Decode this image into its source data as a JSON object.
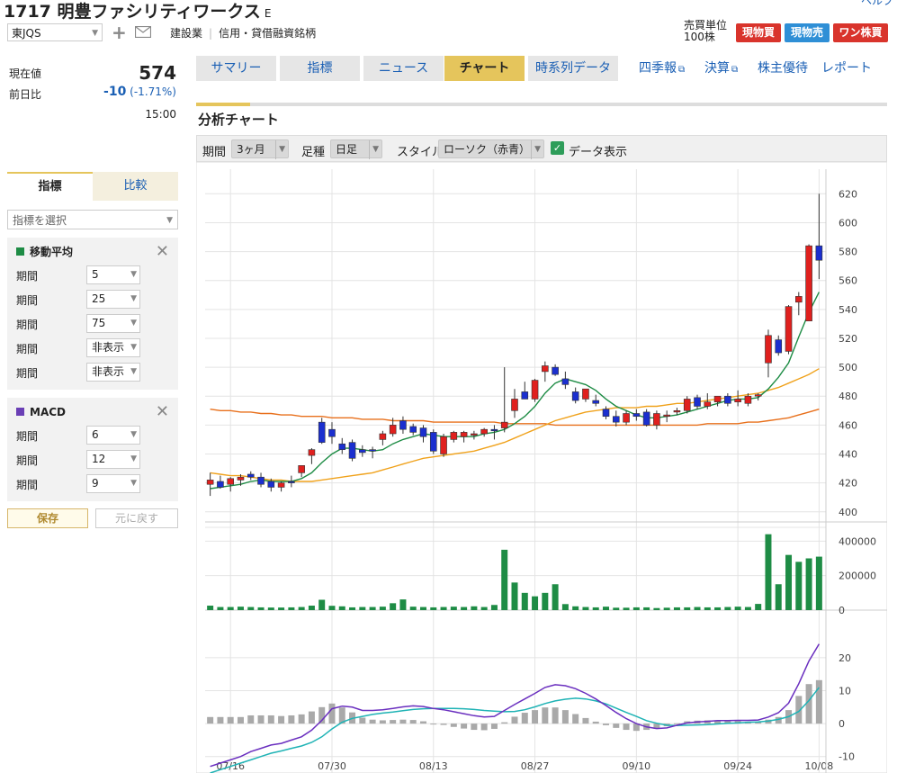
{
  "header": {
    "code": "1717",
    "name": "明豊ファシリティワークス",
    "suffix": "E",
    "corner_link": "ヘルプ",
    "market": "東JQS",
    "industry": "建設業",
    "margin_type": "信用・貸借融資銘柄",
    "unit_label": "売買単位",
    "unit_value": "100株",
    "buttons": {
      "buy": "現物買",
      "sell": "現物売",
      "one": "ワン株買"
    }
  },
  "price": {
    "current_label": "現在値",
    "current_value": "574",
    "change_label": "前日比",
    "change_value": "-10",
    "change_pct": "(-1.71%)",
    "time": "15:00"
  },
  "tabs": [
    {
      "label": "サマリー",
      "active": false
    },
    {
      "label": "指標",
      "active": false
    },
    {
      "label": "ニュース",
      "active": false
    },
    {
      "label": "チャート",
      "active": true
    },
    {
      "label": "時系列データ",
      "active": false
    }
  ],
  "right_links": [
    {
      "label": "四季報",
      "ext": true
    },
    {
      "label": "決算",
      "ext": true
    },
    {
      "label": "株主優待",
      "ext": false
    },
    {
      "label": "レポート",
      "ext": false
    }
  ],
  "section_title": "分析チャート",
  "controls": {
    "period_label": "期間",
    "period_value": "3ヶ月",
    "footype_label": "足種",
    "footype_value": "日足",
    "style_label": "スタイル",
    "style_value": "ローソク（赤青）",
    "data_label": "データ表示",
    "data_checked": true
  },
  "left_panel": {
    "tab_indicator": "指標",
    "tab_compare": "比較",
    "select_placeholder": "指標を選択",
    "ma": {
      "title": "移動平均",
      "color": "#1e8c45",
      "rows": [
        {
          "label": "期間",
          "value": "5"
        },
        {
          "label": "期間",
          "value": "25"
        },
        {
          "label": "期間",
          "value": "75"
        },
        {
          "label": "期間",
          "value": "非表示"
        },
        {
          "label": "期間",
          "value": "非表示"
        }
      ]
    },
    "macd": {
      "title": "MACD",
      "color": "#6a3fb5",
      "rows": [
        {
          "label": "期間",
          "value": "6"
        },
        {
          "label": "期間",
          "value": "12"
        },
        {
          "label": "期間",
          "value": "9"
        }
      ]
    },
    "save": "保存",
    "reset": "元に戻す"
  },
  "chart_data": {
    "type": "candlestick",
    "x_ticks": [
      "07/16",
      "07/30",
      "08/13",
      "08/27",
      "09/10",
      "09/24",
      "10/08"
    ],
    "price_ticks": [
      620,
      600,
      580,
      560,
      540,
      520,
      500,
      480,
      460,
      440,
      420,
      400
    ],
    "price_range": [
      393,
      637
    ],
    "volume_ticks": [
      "400000",
      "200000",
      "0"
    ],
    "volume_range": [
      0,
      480000
    ],
    "macd_ticks": [
      20,
      10,
      0,
      -10
    ],
    "macd_range": [
      -15,
      29
    ],
    "candles": [
      {
        "o": 419,
        "h": 427,
        "l": 411,
        "c": 422
      },
      {
        "o": 421,
        "h": 425,
        "l": 416,
        "c": 417
      },
      {
        "o": 419,
        "h": 424,
        "l": 414,
        "c": 423
      },
      {
        "o": 422,
        "h": 426,
        "l": 418,
        "c": 424
      },
      {
        "o": 426,
        "h": 428,
        "l": 422,
        "c": 424
      },
      {
        "o": 424,
        "h": 427,
        "l": 417,
        "c": 419
      },
      {
        "o": 421,
        "h": 423,
        "l": 414,
        "c": 417
      },
      {
        "o": 417,
        "h": 421,
        "l": 414,
        "c": 420
      },
      {
        "o": 421,
        "h": 425,
        "l": 417,
        "c": 420
      },
      {
        "o": 427,
        "h": 432,
        "l": 424,
        "c": 432
      },
      {
        "o": 439,
        "h": 444,
        "l": 433,
        "c": 443
      },
      {
        "o": 462,
        "h": 465,
        "l": 447,
        "c": 448
      },
      {
        "o": 457,
        "h": 462,
        "l": 447,
        "c": 452
      },
      {
        "o": 447,
        "h": 451,
        "l": 440,
        "c": 443
      },
      {
        "o": 448,
        "h": 450,
        "l": 435,
        "c": 437
      },
      {
        "o": 443,
        "h": 446,
        "l": 438,
        "c": 441
      },
      {
        "o": 443,
        "h": 445,
        "l": 437,
        "c": 442
      },
      {
        "o": 450,
        "h": 456,
        "l": 446,
        "c": 454
      },
      {
        "o": 454,
        "h": 465,
        "l": 452,
        "c": 460
      },
      {
        "o": 463,
        "h": 466,
        "l": 454,
        "c": 457
      },
      {
        "o": 459,
        "h": 461,
        "l": 453,
        "c": 455
      },
      {
        "o": 458,
        "h": 460,
        "l": 448,
        "c": 452
      },
      {
        "o": 455,
        "h": 457,
        "l": 440,
        "c": 442
      },
      {
        "o": 440,
        "h": 454,
        "l": 438,
        "c": 452
      },
      {
        "o": 450,
        "h": 456,
        "l": 448,
        "c": 455
      },
      {
        "o": 452,
        "h": 456,
        "l": 448,
        "c": 455
      },
      {
        "o": 453,
        "h": 456,
        "l": 450,
        "c": 454
      },
      {
        "o": 454,
        "h": 458,
        "l": 452,
        "c": 457
      },
      {
        "o": 457,
        "h": 460,
        "l": 450,
        "c": 456
      },
      {
        "o": 458,
        "h": 500,
        "l": 455,
        "c": 462
      },
      {
        "o": 470,
        "h": 485,
        "l": 465,
        "c": 478
      },
      {
        "o": 483,
        "h": 490,
        "l": 478,
        "c": 478
      },
      {
        "o": 478,
        "h": 492,
        "l": 476,
        "c": 491
      },
      {
        "o": 497,
        "h": 504,
        "l": 490,
        "c": 501
      },
      {
        "o": 500,
        "h": 502,
        "l": 494,
        "c": 495
      },
      {
        "o": 492,
        "h": 497,
        "l": 485,
        "c": 488
      },
      {
        "o": 483,
        "h": 486,
        "l": 475,
        "c": 477
      },
      {
        "o": 478,
        "h": 485,
        "l": 476,
        "c": 485
      },
      {
        "o": 477,
        "h": 481,
        "l": 473,
        "c": 475
      },
      {
        "o": 471,
        "h": 473,
        "l": 464,
        "c": 466
      },
      {
        "o": 466,
        "h": 470,
        "l": 459,
        "c": 462
      },
      {
        "o": 462,
        "h": 470,
        "l": 460,
        "c": 468
      },
      {
        "o": 468,
        "h": 471,
        "l": 463,
        "c": 466
      },
      {
        "o": 469,
        "h": 471,
        "l": 459,
        "c": 460
      },
      {
        "o": 460,
        "h": 470,
        "l": 457,
        "c": 468
      },
      {
        "o": 467,
        "h": 470,
        "l": 462,
        "c": 467
      },
      {
        "o": 469,
        "h": 472,
        "l": 467,
        "c": 470
      },
      {
        "o": 470,
        "h": 480,
        "l": 468,
        "c": 478
      },
      {
        "o": 479,
        "h": 481,
        "l": 471,
        "c": 473
      },
      {
        "o": 473,
        "h": 482,
        "l": 471,
        "c": 476
      },
      {
        "o": 476,
        "h": 480,
        "l": 473,
        "c": 480
      },
      {
        "o": 480,
        "h": 482,
        "l": 473,
        "c": 475
      },
      {
        "o": 476,
        "h": 484,
        "l": 473,
        "c": 478
      },
      {
        "o": 475,
        "h": 482,
        "l": 473,
        "c": 480
      },
      {
        "o": 480,
        "h": 482,
        "l": 477,
        "c": 481
      },
      {
        "o": 503,
        "h": 526,
        "l": 493,
        "c": 522
      },
      {
        "o": 519,
        "h": 522,
        "l": 508,
        "c": 510
      },
      {
        "o": 511,
        "h": 543,
        "l": 509,
        "c": 542
      },
      {
        "o": 545,
        "h": 552,
        "l": 536,
        "c": 549
      },
      {
        "o": 532,
        "h": 585,
        "l": 532,
        "c": 584
      },
      {
        "o": 584,
        "h": 620,
        "l": 561,
        "c": 574
      }
    ],
    "ma5": [
      416,
      417,
      418,
      419,
      421,
      422,
      421,
      421,
      421,
      423,
      427,
      434,
      440,
      444,
      444,
      443,
      442,
      443,
      447,
      450,
      452,
      454,
      453,
      452,
      452,
      452,
      452,
      454,
      455,
      457,
      461,
      466,
      473,
      482,
      489,
      492,
      490,
      488,
      484,
      478,
      473,
      470,
      467,
      465,
      465,
      466,
      467,
      469,
      471,
      473,
      475,
      477,
      478,
      478,
      479,
      485,
      493,
      503,
      521,
      538,
      552
    ],
    "ma25": [
      427,
      426,
      425,
      425,
      424,
      423,
      422,
      422,
      421,
      421,
      421,
      422,
      423,
      424,
      425,
      426,
      427,
      429,
      431,
      433,
      435,
      437,
      438,
      439,
      440,
      441,
      442,
      444,
      446,
      448,
      451,
      454,
      457,
      460,
      463,
      465,
      467,
      469,
      470,
      471,
      472,
      472,
      472,
      473,
      473,
      474,
      475,
      475,
      476,
      477,
      478,
      479,
      480,
      481,
      482,
      484,
      486,
      489,
      492,
      495,
      499
    ],
    "ma75": [
      471,
      470,
      470,
      469,
      469,
      468,
      468,
      467,
      467,
      466,
      466,
      466,
      465,
      465,
      465,
      464,
      464,
      464,
      463,
      463,
      463,
      463,
      462,
      462,
      462,
      462,
      462,
      462,
      462,
      461,
      461,
      461,
      461,
      461,
      460,
      460,
      460,
      460,
      460,
      460,
      460,
      460,
      460,
      460,
      460,
      460,
      460,
      460,
      460,
      461,
      461,
      461,
      461,
      462,
      462,
      463,
      464,
      465,
      467,
      469,
      471
    ],
    "volume": [
      26000,
      18000,
      18000,
      20000,
      18000,
      16000,
      15000,
      15000,
      16000,
      18000,
      26000,
      60000,
      25000,
      22000,
      16000,
      18000,
      18000,
      20000,
      40000,
      62000,
      20000,
      18000,
      16000,
      18000,
      20000,
      18000,
      22000,
      18000,
      30000,
      350000,
      160000,
      100000,
      80000,
      100000,
      150000,
      35000,
      22000,
      18000,
      16000,
      20000,
      14000,
      14000,
      16000,
      16000,
      12000,
      14000,
      16000,
      16000,
      18000,
      16000,
      16000,
      18000,
      20000,
      18000,
      36000,
      440000,
      150000,
      320000,
      280000,
      300000,
      310000
    ],
    "macd": [
      -13,
      -12,
      -11,
      -10,
      -8.5,
      -7.5,
      -6.5,
      -6,
      -5,
      -4,
      -2,
      1,
      4.5,
      5.3,
      5,
      4,
      4,
      4.2,
      4.6,
      5.1,
      5.4,
      5.2,
      4.6,
      4.2,
      3.6,
      3,
      2.4,
      2,
      2.2,
      4,
      5.8,
      7.5,
      9.2,
      11,
      11.8,
      11.5,
      10.6,
      9.2,
      7.5,
      5.5,
      3.4,
      1.5,
      0,
      -1,
      -1.5,
      -1.3,
      -0.5,
      0.2,
      0.5,
      0.7,
      0.9,
      0.9,
      1,
      1,
      1.1,
      2,
      3.3,
      6.2,
      12.1,
      19,
      24.2
    ],
    "signal": [
      -15,
      -14,
      -13,
      -12,
      -11,
      -10,
      -9,
      -8.3,
      -7.5,
      -6.8,
      -5.7,
      -4,
      -1.6,
      0.4,
      1.6,
      2.2,
      2.8,
      3.2,
      3.5,
      3.9,
      4.3,
      4.5,
      4.6,
      4.6,
      4.6,
      4.5,
      4.3,
      4,
      3.8,
      3.6,
      3.7,
      4.2,
      5.1,
      6.1,
      6.9,
      7.4,
      7.7,
      7.5,
      6.9,
      6,
      4.7,
      3.4,
      2.2,
      0.9,
      0.1,
      -0.5,
      -0.6,
      -0.5,
      -0.4,
      -0.3,
      -0.1,
      0.1,
      0.2,
      0.4,
      0.5,
      0.8,
      1.3,
      2.1,
      3.7,
      7,
      11
    ],
    "colors": {
      "up": "#e0201e",
      "down": "#1b2fcf",
      "ma5": "#1e8c45",
      "ma25": "#f0a21c",
      "ma75": "#e8701c",
      "volume": "#1e8c45",
      "macd": "#6a2fbf",
      "signal": "#1fb3b5",
      "hist": "#a9a9a9"
    }
  }
}
